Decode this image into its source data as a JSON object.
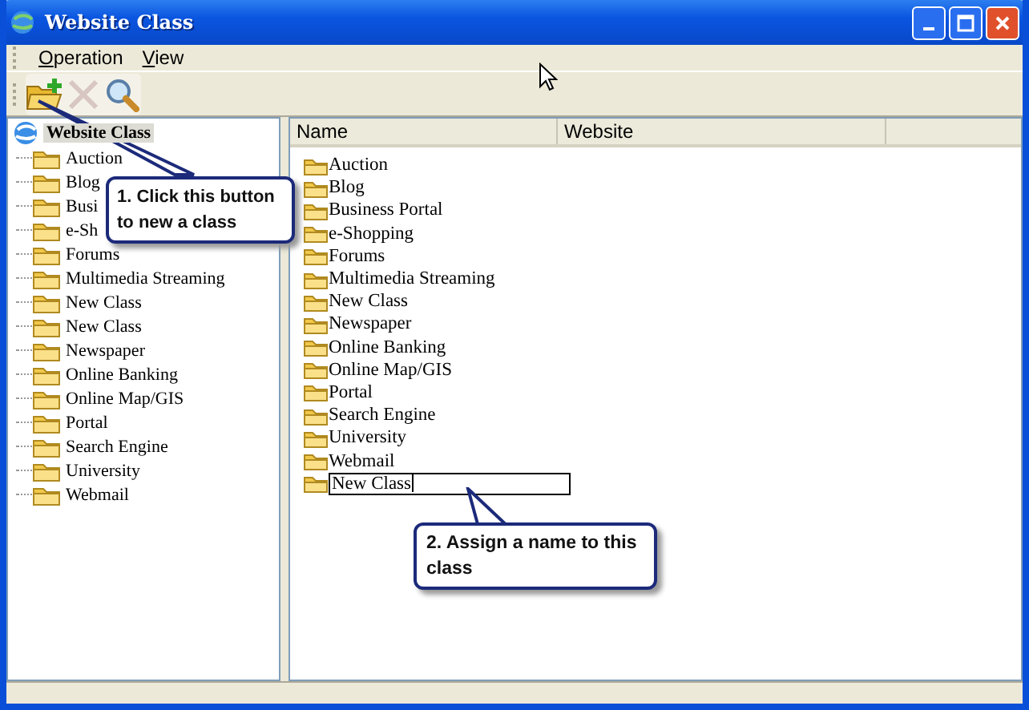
{
  "window": {
    "title": "Website Class"
  },
  "menu": [
    {
      "label": "Operation"
    },
    {
      "label": "View"
    }
  ],
  "toolbar": [
    {
      "kind": "new-folder",
      "disabled": false
    },
    {
      "kind": "delete",
      "disabled": true
    },
    {
      "kind": "search",
      "disabled": false
    }
  ],
  "tree": {
    "label": "Website Class",
    "selected": true,
    "children": [
      {
        "label": "Auction"
      },
      {
        "label": "Blog"
      },
      {
        "label": "Busi"
      },
      {
        "label": "e-Sh"
      },
      {
        "label": "Forums"
      },
      {
        "label": "Multimedia Streaming"
      },
      {
        "label": "New Class"
      },
      {
        "label": "New Class"
      },
      {
        "label": "Newspaper"
      },
      {
        "label": "Online Banking"
      },
      {
        "label": "Online Map/GIS"
      },
      {
        "label": "Portal"
      },
      {
        "label": "Search Engine"
      },
      {
        "label": "University"
      },
      {
        "label": "Webmail"
      }
    ]
  },
  "list": {
    "columns": [
      "Name",
      "Website"
    ],
    "rows": [
      {
        "name": "Auction",
        "editing": false
      },
      {
        "name": "Blog",
        "editing": false
      },
      {
        "name": "Business Portal",
        "editing": false
      },
      {
        "name": "e-Shopping",
        "editing": false
      },
      {
        "name": "Forums",
        "editing": false
      },
      {
        "name": "Multimedia Streaming",
        "editing": false
      },
      {
        "name": "New Class",
        "editing": false
      },
      {
        "name": "Newspaper",
        "editing": false
      },
      {
        "name": "Online Banking",
        "editing": false
      },
      {
        "name": "Online Map/GIS",
        "editing": false
      },
      {
        "name": "Portal",
        "editing": false
      },
      {
        "name": "Search Engine",
        "editing": false
      },
      {
        "name": "University",
        "editing": false
      },
      {
        "name": "Webmail",
        "editing": false
      },
      {
        "name": "New Class",
        "editing": true
      }
    ]
  },
  "callouts": [
    {
      "text": "1. Click this button to new a class"
    },
    {
      "text": "2. Assign a name to this class"
    }
  ]
}
